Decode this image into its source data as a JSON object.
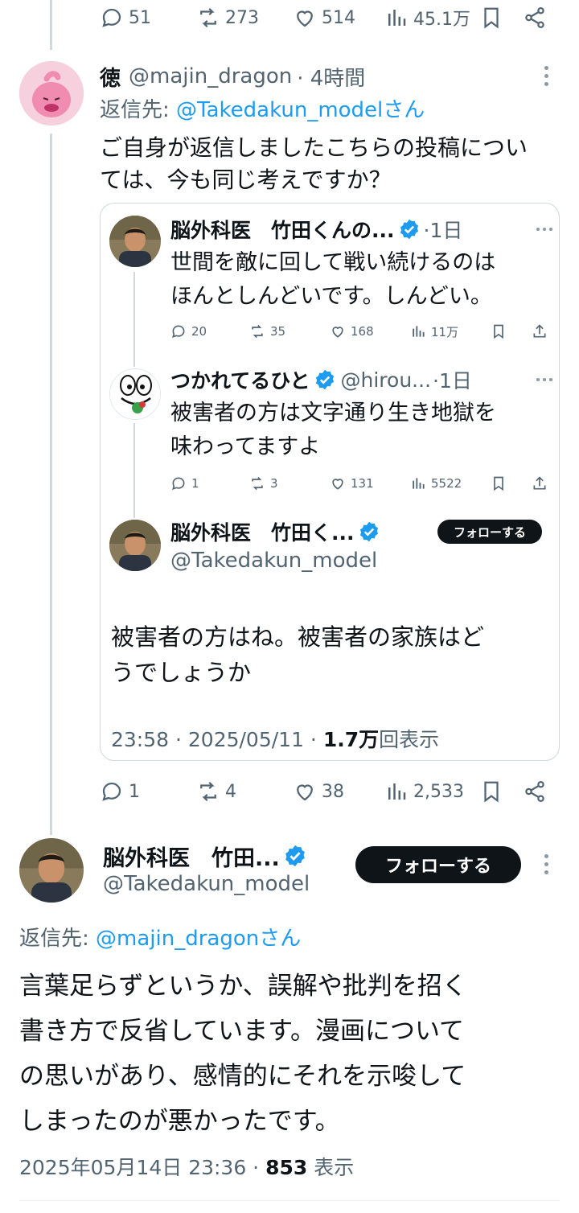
{
  "top_actions": {
    "replies": "51",
    "retweets": "273",
    "likes": "514",
    "views": "45.1万"
  },
  "reply1": {
    "name": "徳",
    "handle": "@majin_dragon",
    "time": "· 4時間",
    "replying_prefix": "返信先: ",
    "replying_to": "@Takedakun_modelさん",
    "text_line1": "ご自身が返信しましたこちらの投稿につい",
    "text_line2": "ては、今も同じ考えですか？"
  },
  "quote": {
    "t1": {
      "name": "脳外科医　竹田くんの...",
      "time": "·1日",
      "line1": "世間を敵に回して戦い続けるのは",
      "line2": "ほんとしんどいです。しんどい。",
      "replies": "20",
      "retweets": "35",
      "likes": "168",
      "views": "11万"
    },
    "t2": {
      "name": "つかれてるひと",
      "handle": "@hirou...",
      "time": "·1日",
      "line1": "被害者の方は文字通り生き地獄を",
      "line2": "味わってますよ",
      "replies": "1",
      "retweets": "3",
      "likes": "131",
      "views": "5522"
    },
    "t3": {
      "name": "脳外科医　竹田く...",
      "handle": "@Takedakun_model",
      "follow_label": "フォローする",
      "line1": "被害者の方はね。被害者の家族はど",
      "line2": "うでしょうか",
      "time": "23:58 · 2025/05/11 · ",
      "views_num": "1.7万",
      "views_suffix": "回表示"
    }
  },
  "reply1_actions": {
    "replies": "1",
    "retweets": "4",
    "likes": "38",
    "views": "2,533"
  },
  "main": {
    "name": "脳外科医　竹田...",
    "handle": "@Takedakun_model",
    "follow_label": "フォローする",
    "replying_prefix": "返信先: ",
    "replying_to": "@majin_dragonさん",
    "line1": "言葉足らずというか、誤解や批判を招く",
    "line2": "書き方で反省しています。漫画について",
    "line3": "の思いがあり、感情的にそれを示唆して",
    "line4": "しまったのが悪かったです。",
    "timestamp": "2025年05月14日 23:36 · ",
    "views_num": "853",
    "views_suffix": " 表示"
  },
  "colors": {
    "accent": "#1d9bf0",
    "text": "#0f1419",
    "muted": "#536471",
    "border": "#cfd9de"
  }
}
